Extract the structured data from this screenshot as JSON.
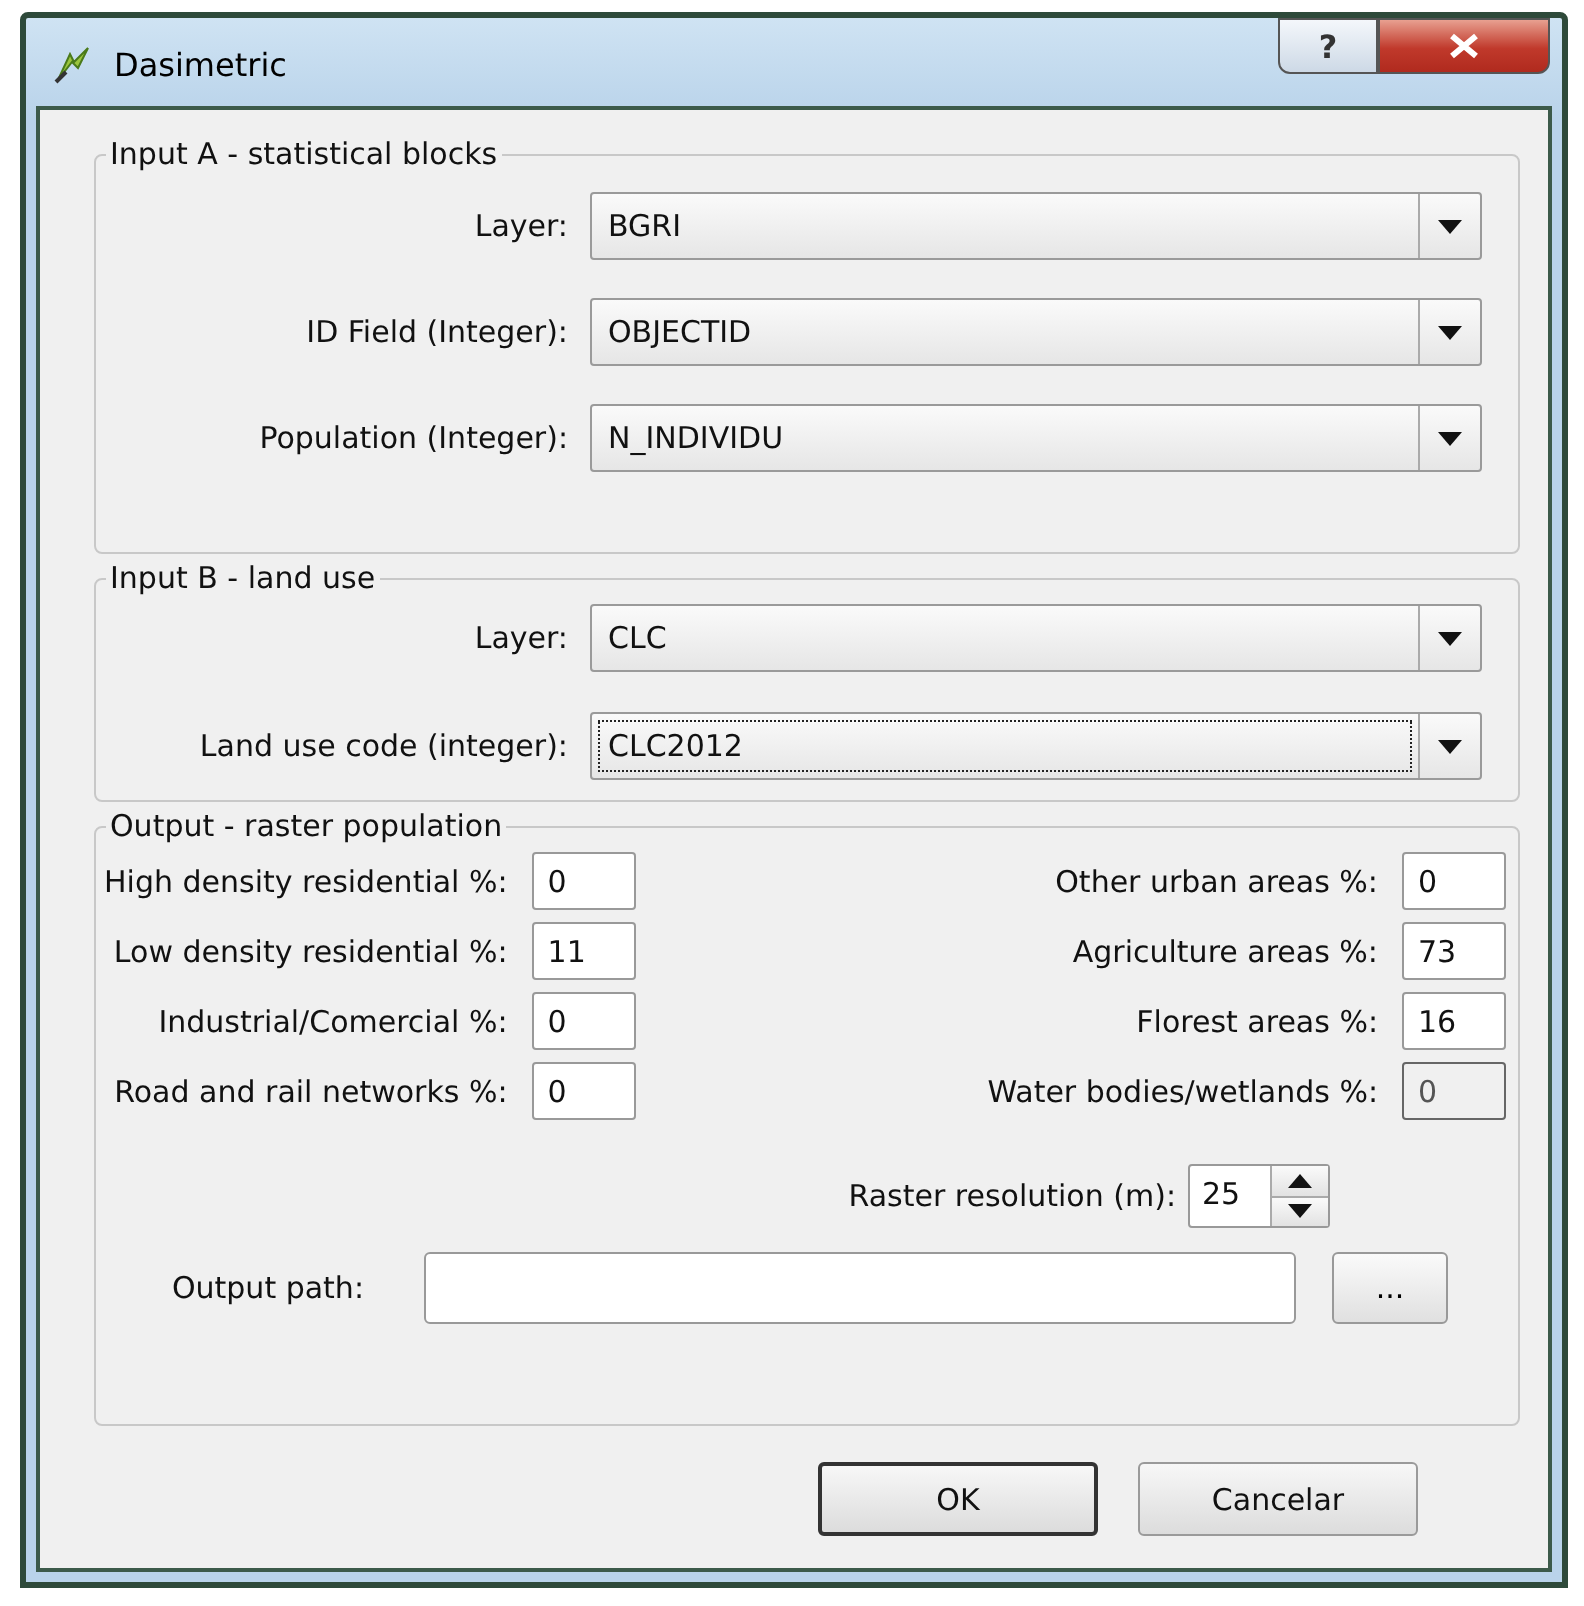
{
  "window": {
    "title": "Dasimetric",
    "help": "?"
  },
  "input_a": {
    "title": "Input A - statistical blocks",
    "rows": [
      {
        "label": "Layer:",
        "value": "BGRI",
        "focused": false
      },
      {
        "label": "ID Field (Integer):",
        "value": "OBJECTID",
        "focused": false
      },
      {
        "label": "Population (Integer):",
        "value": "N_INDIVIDU",
        "focused": false
      }
    ]
  },
  "input_b": {
    "title": "Input B - land use",
    "rows": [
      {
        "label": "Layer:",
        "value": "CLC",
        "focused": false
      },
      {
        "label": "Land use code (integer):",
        "value": "CLC2012",
        "focused": true
      }
    ]
  },
  "output": {
    "title": "Output - raster population",
    "left_fields": [
      {
        "label": "High density residential %:",
        "value": "0",
        "disabled": false
      },
      {
        "label": "Low density residential %:",
        "value": "11",
        "disabled": false
      },
      {
        "label": "Industrial/Comercial %:",
        "value": "0",
        "disabled": false
      },
      {
        "label": "Road and rail networks %:",
        "value": "0",
        "disabled": false
      }
    ],
    "right_fields": [
      {
        "label": "Other urban areas %:",
        "value": "0",
        "disabled": false
      },
      {
        "label": "Agriculture areas %:",
        "value": "73",
        "disabled": false
      },
      {
        "label": "Florest areas %:",
        "value": "16",
        "disabled": false
      },
      {
        "label": "Water bodies/wetlands %:",
        "value": "0",
        "disabled": true
      }
    ],
    "resolution": {
      "label": "Raster resolution (m):",
      "value": "25"
    },
    "path": {
      "label": "Output path:",
      "browse": "..."
    }
  },
  "buttons": [
    {
      "label": "OK",
      "default": true
    },
    {
      "label": "Cancelar",
      "default": false
    }
  ]
}
